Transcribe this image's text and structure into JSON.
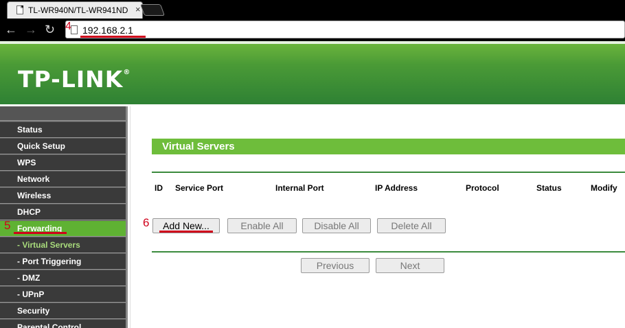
{
  "browser": {
    "tab_title": "TL-WR940N/TL-WR941ND",
    "close_glyph": "×",
    "back_glyph": "←",
    "forward_glyph": "→",
    "reload_glyph": "↻",
    "url": "192.168.2.1"
  },
  "header": {
    "logo": "TP-LINK",
    "logo_reg": "®",
    "brand_color": "#4a9a36"
  },
  "sidebar": {
    "items": [
      {
        "label": "Status"
      },
      {
        "label": "Quick Setup"
      },
      {
        "label": "WPS"
      },
      {
        "label": "Network"
      },
      {
        "label": "Wireless"
      },
      {
        "label": "DHCP"
      },
      {
        "label": "Forwarding"
      },
      {
        "label": "- Virtual Servers"
      },
      {
        "label": "- Port Triggering"
      },
      {
        "label": "- DMZ"
      },
      {
        "label": "- UPnP"
      },
      {
        "label": "Security"
      },
      {
        "label": "Parental Control"
      }
    ]
  },
  "main": {
    "section_title": "Virtual Servers",
    "columns": [
      "ID",
      "Service Port",
      "Internal Port",
      "IP Address",
      "Protocol",
      "Status",
      "Modify"
    ],
    "buttons": {
      "add_new": "Add New...",
      "enable_all": "Enable All",
      "disable_all": "Disable All",
      "delete_all": "Delete All",
      "previous": "Previous",
      "next": "Next"
    }
  },
  "annotations": {
    "step4": "4",
    "step5": "5",
    "step6": "6",
    "color": "#d0021b"
  }
}
